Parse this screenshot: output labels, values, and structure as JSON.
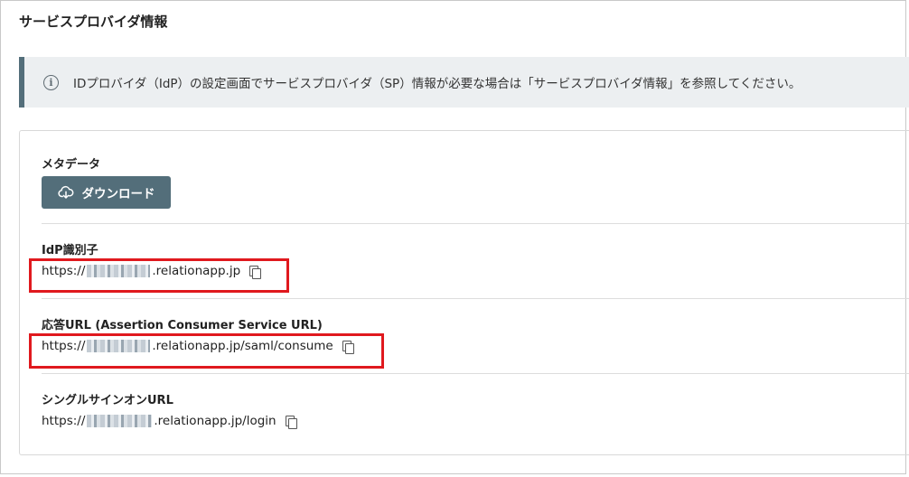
{
  "page": {
    "title": "サービスプロバイダ情報"
  },
  "banner": {
    "icon": "info-icon",
    "text": "IDプロバイダ（IdP）の設定画面でサービスプロバイダ（SP）情報が必要な場合は「サービスプロバイダ情報」を参照してください。"
  },
  "metadata": {
    "label": "メタデータ",
    "download_label": "ダウンロード",
    "download_icon": "cloud-download-icon"
  },
  "idp_identifier": {
    "label": "IdP識別子",
    "prefix": "https://",
    "suffix": ".relationapp.jp"
  },
  "acs_url": {
    "label": "応答URL (Assertion Consumer Service URL)",
    "prefix": "https://",
    "suffix": ".relationapp.jp/saml/consume"
  },
  "sso_url": {
    "label": "シングルサインオンURL",
    "prefix": "https://",
    "suffix": ".relationapp.jp/login"
  },
  "colors": {
    "accent": "#536e7a",
    "banner_bg": "#eceff1",
    "highlight": "#e0191e"
  }
}
